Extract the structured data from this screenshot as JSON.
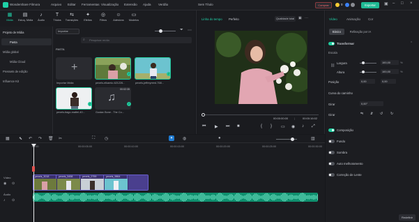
{
  "app": {
    "title": "Wondershare Filmora",
    "project": "Sem Título",
    "menu": [
      "Arquivo",
      "Editar",
      "Ferramentas",
      "Visualização",
      "Extensão",
      "Ajuda",
      "Verdão"
    ],
    "buy_label": "Comprar",
    "export_label": "Exportar",
    "coin_count": "0"
  },
  "toolbar": {
    "items": [
      {
        "icon": "film-icon",
        "label": "Mídia"
      },
      {
        "icon": "stock-icon",
        "label": "Estoq. Mídia"
      },
      {
        "icon": "music-icon",
        "label": "Áudio"
      },
      {
        "icon": "text-icon",
        "label": "Títulos"
      },
      {
        "icon": "transition-icon",
        "label": "Transições"
      },
      {
        "icon": "effects-icon",
        "label": "Efeitos"
      },
      {
        "icon": "filter-icon",
        "label": "Filtros"
      },
      {
        "icon": "sticker-icon",
        "label": "Adesivos"
      },
      {
        "icon": "template-icon",
        "label": "Modelos"
      }
    ]
  },
  "nav": {
    "items": [
      "Projeto de Mídia",
      "Pasta",
      "Mídia global",
      "Mídia Cloud",
      "Pressets de edição",
      "Influence Kit"
    ]
  },
  "media": {
    "sort": "Importar",
    "search_placeholder": "Pesquisar mídia",
    "folder": "PASTA",
    "import_label": "Importar Mídia",
    "items": [
      {
        "name": "pexels-elkamio-621226...",
        "time": ""
      },
      {
        "name": "pexels-jeffreyreed-768...",
        "time": ""
      },
      {
        "name": "pexels-tiago-mattei-40...",
        "time": ""
      },
      {
        "name": "Gustav Bone - The Co...",
        "time": "00:02:35"
      }
    ]
  },
  "preview": {
    "timeline_label": "Linha do tempo",
    "status": "Perfeito",
    "quality": "Qualidade total",
    "time_current": "00:00:00:00",
    "time_total": "00:00:16:02"
  },
  "inspector": {
    "tabs": [
      "Vídeo",
      "Animação",
      "Cor"
    ],
    "subtabs": [
      "Básico",
      "Refinação por IA"
    ],
    "transform": "Transformar",
    "scale": "Escala",
    "width": "Largura",
    "height": "Altura",
    "width_value": "100,00",
    "height_value": "100,00",
    "position": "Posição",
    "pos_x": "0,00",
    "pos_y": "0,00",
    "curve": "Curva do caminho",
    "rotate": "Girar",
    "rotate_value": "0,00°",
    "flip": "Girar",
    "composition": "Composição",
    "background": "Fundo",
    "shadow": "Sombra",
    "auto_enhance": "Auto melhoramento",
    "lens": "Correção de Lente",
    "reset": "Redefinir"
  },
  "timeline": {
    "ruler_ticks": [
      "00:00",
      "00:00:05:00",
      "00:00:10:00",
      "00:00:15:00",
      "00:00:20:00",
      "00:00:25:00",
      "00:00:30:00",
      "00:00:35:00"
    ],
    "video_track": "Vídeo",
    "audio_track": "Áudio",
    "clips": [
      "pexels_3018",
      "pexels_5458",
      "pexels_2759",
      "pexels_9864"
    ]
  }
}
